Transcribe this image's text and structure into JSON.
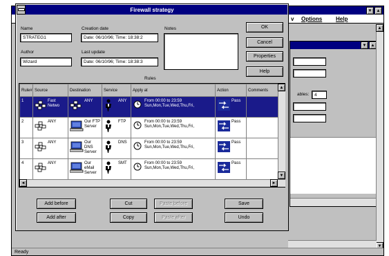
{
  "bg_window": {
    "menu": [
      "v",
      "Options",
      "Help"
    ],
    "status": "Ready",
    "inner_field_label": "ables:",
    "inner_field_value": "4"
  },
  "dialog": {
    "title": "Firewall strategy",
    "name_label": "Name",
    "name_value": "STRATEG1",
    "creation_label": "Creation date",
    "creation_value": "Date: 06/10/96; Time: 18:38:2",
    "notes_label": "Notes",
    "author_label": "Author",
    "author_value": "Wizard",
    "update_label": "Last update",
    "update_value": "Date: 06/10/96; Time: 18:38:3",
    "rules_label": "Rules",
    "side_buttons": [
      "OK",
      "Cancel",
      "Properties",
      "Help"
    ],
    "bottom_buttons": {
      "add_before": "Add before",
      "add_after": "Add after",
      "cut": "Cut",
      "copy": "Copy",
      "paste_before": "Paste before",
      "paste_after": "Paste after",
      "save": "Save",
      "undo": "Undo"
    }
  },
  "table": {
    "columns": [
      "Rule#",
      "Source",
      "Destination",
      "Service",
      "Apply at",
      "Action",
      "Comments"
    ],
    "rows": [
      {
        "num": "1",
        "source": "Fast Netwo",
        "dest": "ANY",
        "service": "ANY",
        "apply1": "From 00:00 to 23:59",
        "apply2": "Sun,Mon,Tue,Wed,Thu,Fri,",
        "action": "Pass",
        "selected": true
      },
      {
        "num": "2",
        "source": "ANY",
        "dest": "Our FTP Server",
        "service": "FTP",
        "apply1": "From 00:00 to 23:59",
        "apply2": "Sun,Mon,Tue,Wed,Thu,Fri,",
        "action": "Pass",
        "selected": false
      },
      {
        "num": "3",
        "source": "ANY",
        "dest": "Our DNS Server",
        "service": "DNS",
        "apply1": "From 00:00 to 23:59",
        "apply2": "Sun,Mon,Tue,Wed,Thu,Fri,",
        "action": "Pass",
        "selected": false
      },
      {
        "num": "4",
        "source": "ANY",
        "dest": "Our eMail Server",
        "service": "SMT",
        "apply1": "From 00:00 to 23:59",
        "apply2": "Sun,Mon,Tue,Wed,Thu,Fri,",
        "action": "Pass",
        "selected": false
      }
    ]
  },
  "colors": {
    "titlebar": "#000080",
    "selection": "#1a1a8a",
    "face": "#c0c0c0"
  }
}
